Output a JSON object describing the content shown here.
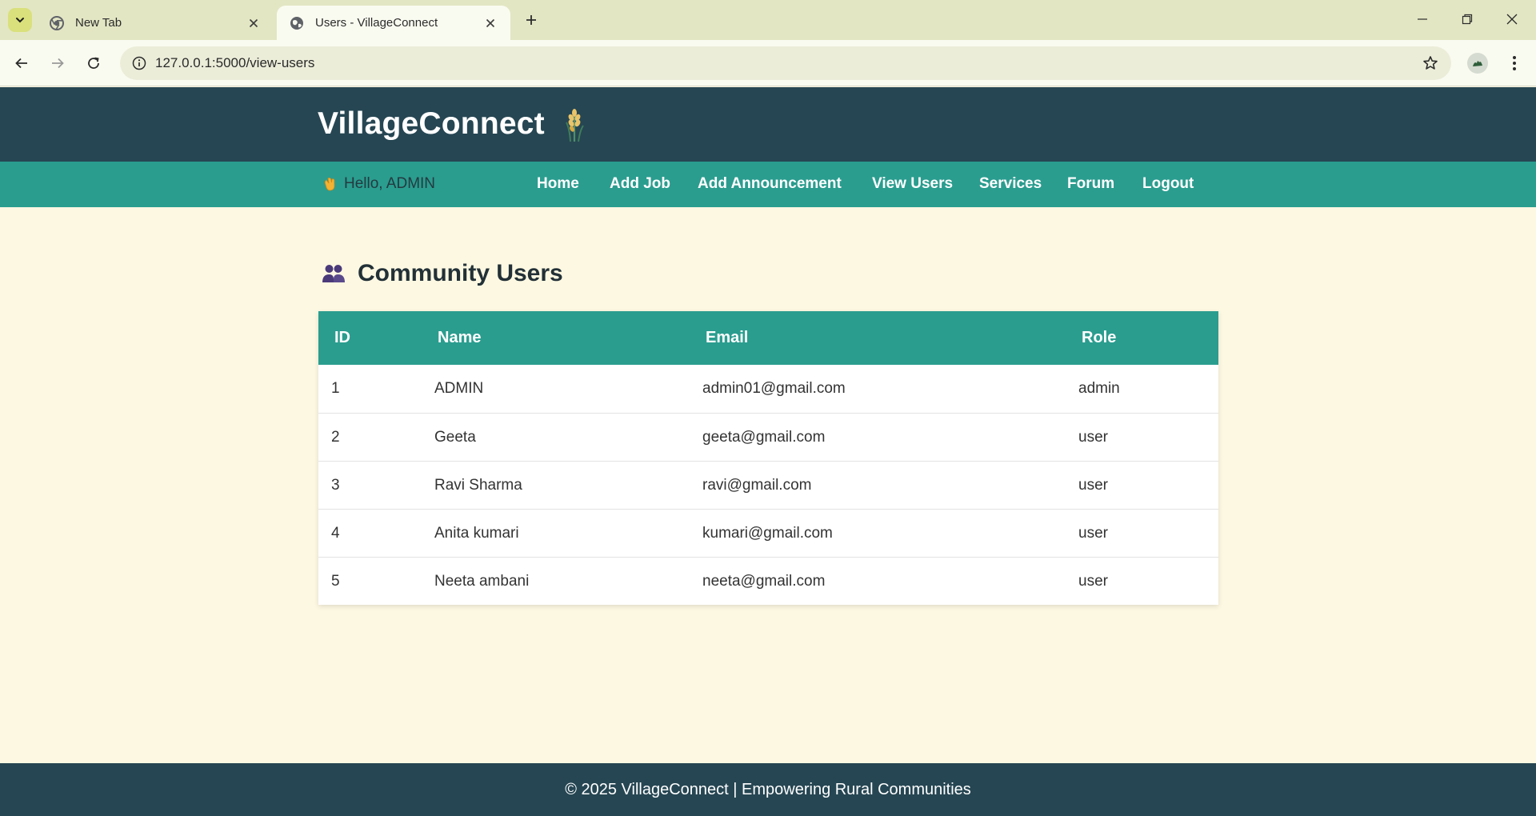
{
  "browser": {
    "tabs": [
      {
        "title": "New Tab",
        "icon": "chrome-icon",
        "active": false
      },
      {
        "title": "Users - VillageConnect",
        "icon": "globe-icon",
        "active": true
      }
    ],
    "url": "127.0.0.1:5000/view-users"
  },
  "site": {
    "brand": "VillageConnect",
    "brand_icon": "wheat-icon",
    "greeting": "Hello, ADMIN",
    "nav": {
      "home": "Home",
      "add_job": "Add Job",
      "add_announcement": "Add Announcement",
      "view_users": "View Users",
      "services": "Services",
      "forum": "Forum",
      "logout": "Logout"
    }
  },
  "main": {
    "title": "Community Users",
    "title_icon": "users-icon",
    "table": {
      "headers": {
        "id": "ID",
        "name": "Name",
        "email": "Email",
        "role": "Role"
      },
      "rows": [
        {
          "id": "1",
          "name": "ADMIN",
          "email": "admin01@gmail.com",
          "role": "admin"
        },
        {
          "id": "2",
          "name": "Geeta",
          "email": "geeta@gmail.com",
          "role": "user"
        },
        {
          "id": "3",
          "name": "Ravi Sharma",
          "email": "ravi@gmail.com",
          "role": "user"
        },
        {
          "id": "4",
          "name": "Anita kumari",
          "email": "kumari@gmail.com",
          "role": "user"
        },
        {
          "id": "5",
          "name": "Neeta ambani",
          "email": "neeta@gmail.com",
          "role": "user"
        }
      ]
    }
  },
  "footer": {
    "text": "© 2025 VillageConnect | Empowering Rural Communities"
  },
  "colors": {
    "header": "#264653",
    "nav": "#2a9d8f",
    "page_background": "#fdf8e2",
    "table_header": "#2a9d8f"
  }
}
